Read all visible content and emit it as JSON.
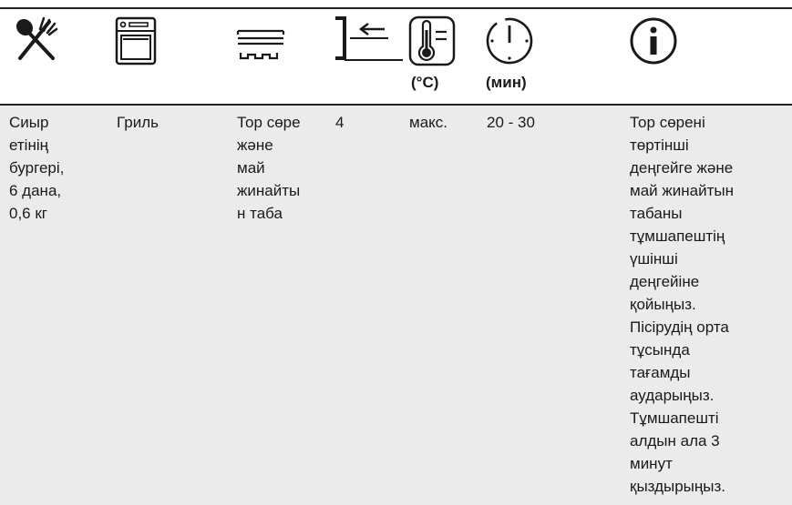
{
  "header": {
    "icons": [
      "food-icon",
      "oven-function-icon",
      "shelf-accessory-icon",
      "shelf-level-icon",
      "temperature-icon",
      "time-icon",
      "info-icon"
    ],
    "temperature_unit": "(°C)",
    "time_unit": "(мин)"
  },
  "row": {
    "food": "Сиыр\nетінің\nбургері,\n6 дана,\n0,6 кг",
    "function": "Гриль",
    "accessory": "Тор сөре\nжәне\nмай\nжинайты\nн таба",
    "level": "4",
    "temperature": "макс.",
    "time": "20 - 30",
    "comments": "Тор сөрені\nтөртінші\nдеңгейге және\nмай жинайтын\nтабаны\nтұмшапештің\nүшінші\nдеңгейіне\nқойыңыз.\nПісірудің орта\nтұсында\nтағамды\nаударыңыз.\nТұмшапешті\nалдын ала 3\nминут\nқыздырыңыз."
  }
}
